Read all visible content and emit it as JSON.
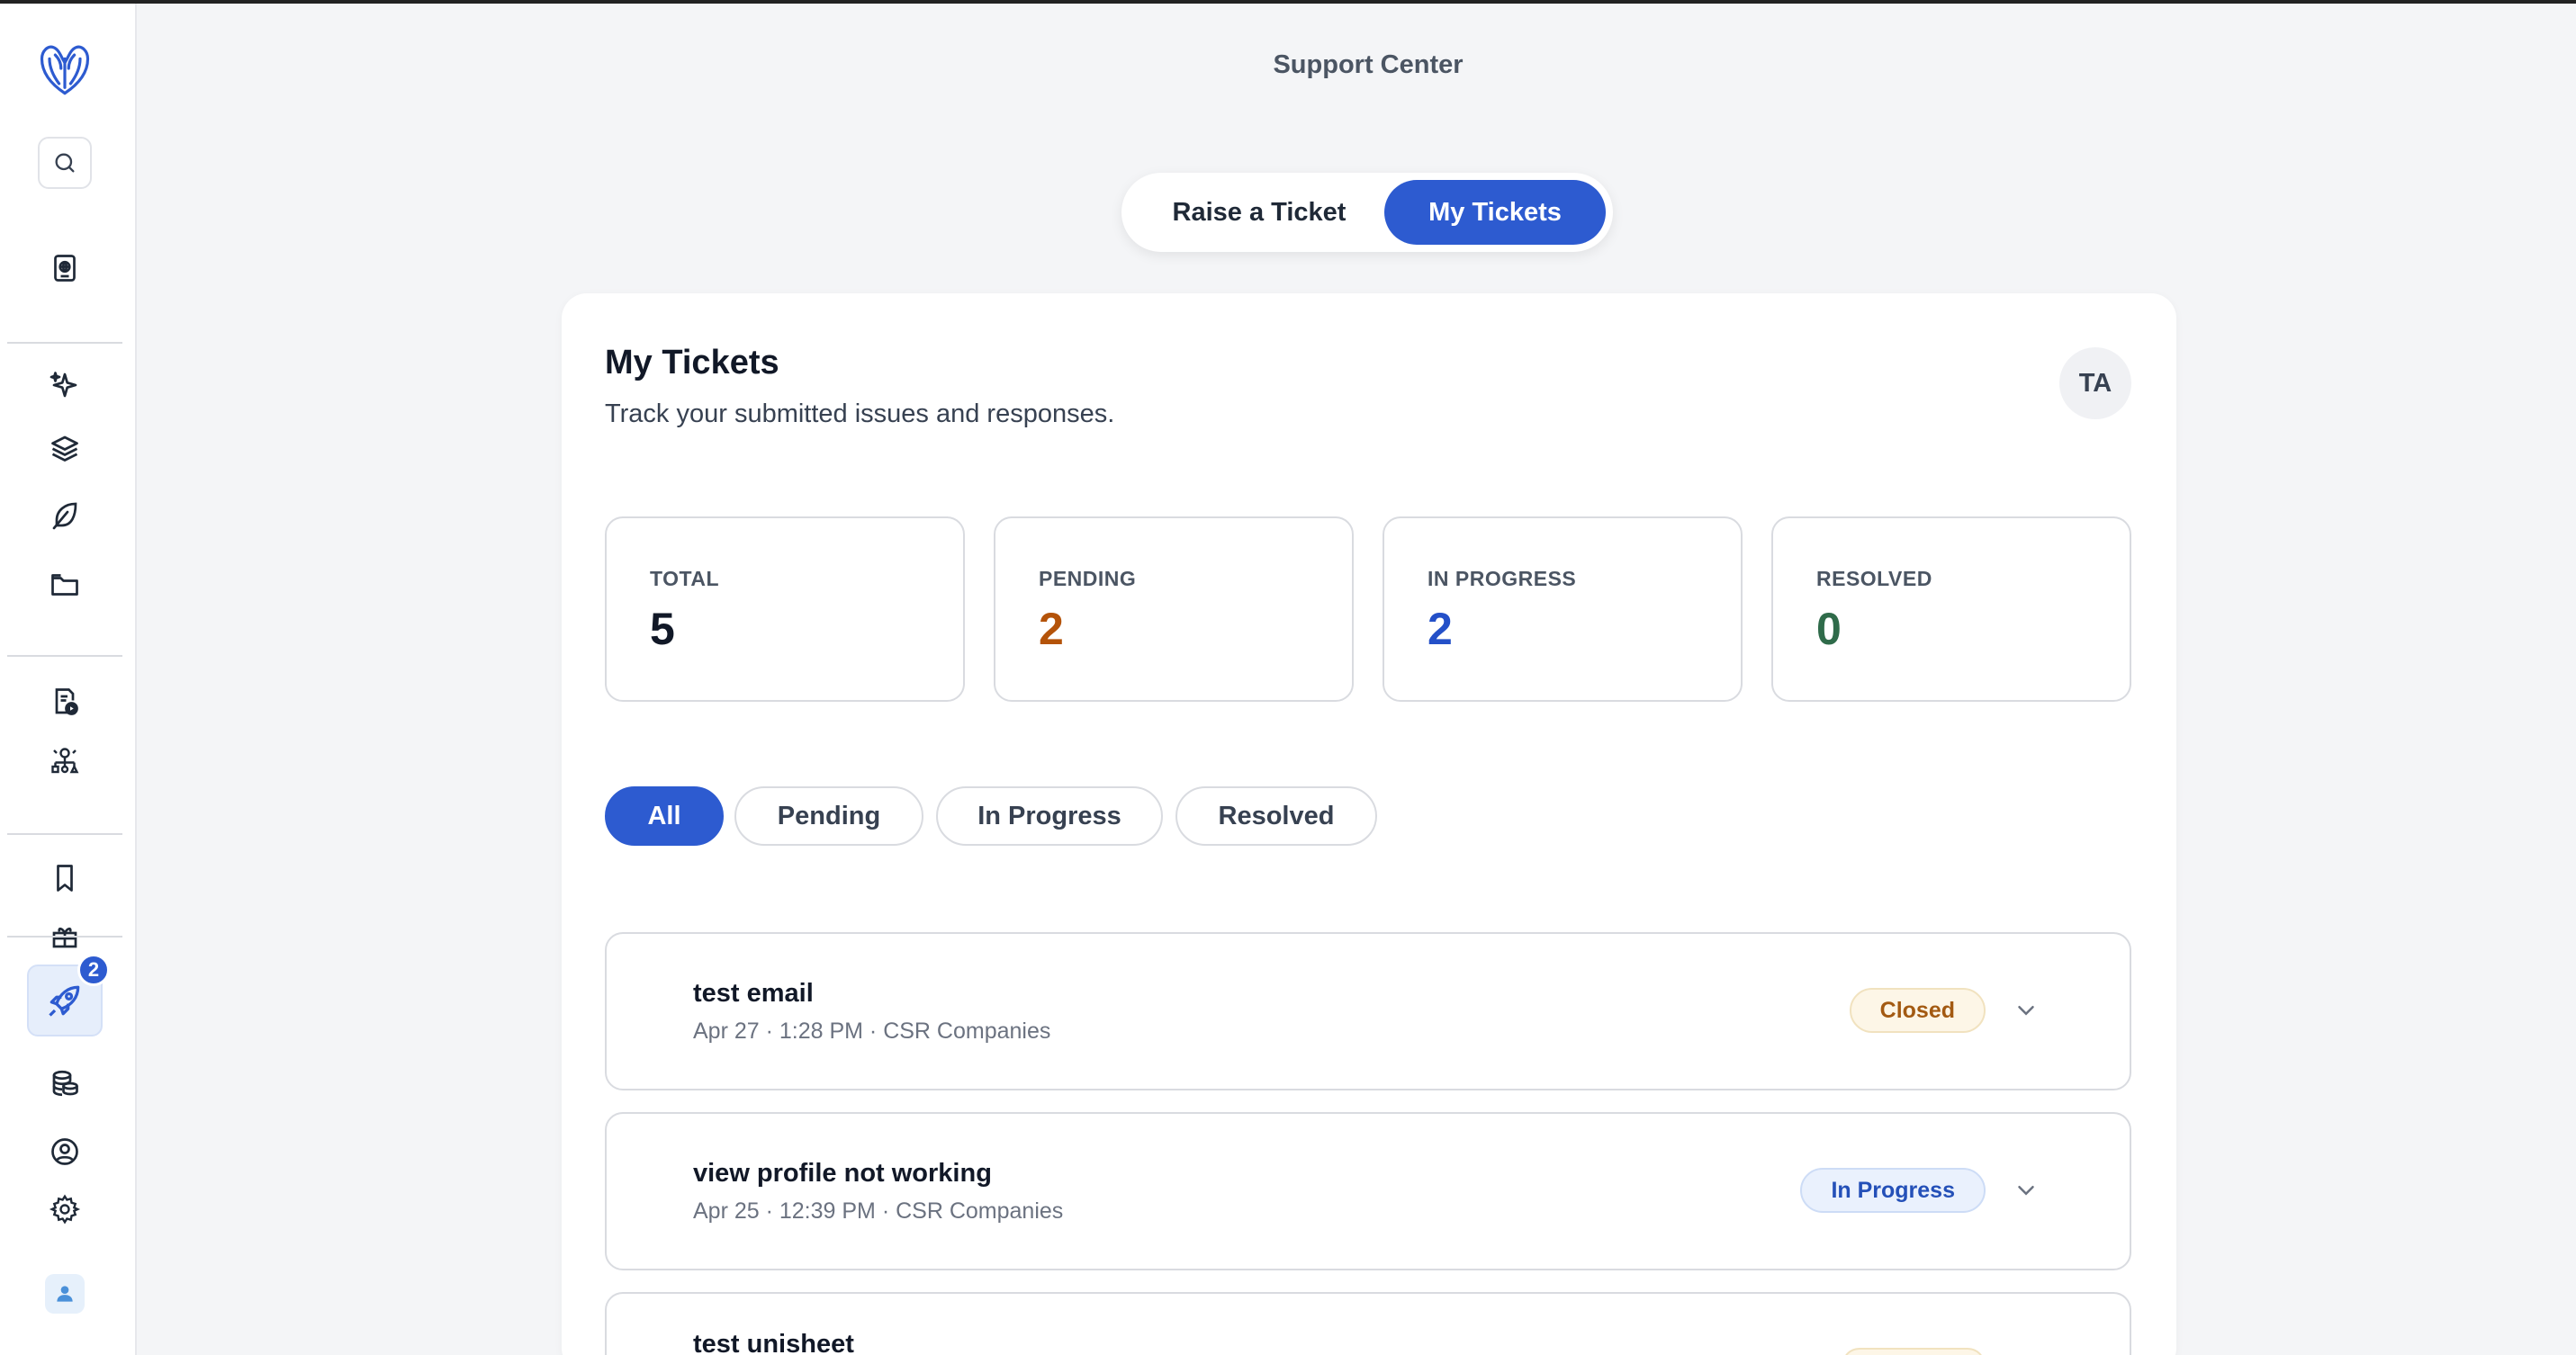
{
  "header": {
    "title": "Support Center"
  },
  "tabs": [
    {
      "label": "Raise a Ticket",
      "active": false
    },
    {
      "label": "My Tickets",
      "active": true
    }
  ],
  "card": {
    "title": "My Tickets",
    "subtitle": "Track your submitted issues and responses.",
    "avatar_initials": "TA"
  },
  "stats": [
    {
      "label": "TOTAL",
      "value": "5",
      "color": "#111827"
    },
    {
      "label": "PENDING",
      "value": "2",
      "color": "#b45309"
    },
    {
      "label": "IN PROGRESS",
      "value": "2",
      "color": "#2450c8"
    },
    {
      "label": "RESOLVED",
      "value": "0",
      "color": "#2f6b4a"
    }
  ],
  "filters": [
    {
      "label": "All",
      "selected": true
    },
    {
      "label": "Pending",
      "selected": false
    },
    {
      "label": "In Progress",
      "selected": false
    },
    {
      "label": "Resolved",
      "selected": false
    }
  ],
  "tickets": [
    {
      "title": "test email",
      "meta": "Apr 27 · 1:28 PM · CSR Companies",
      "status": "Closed"
    },
    {
      "title": "view profile not working",
      "meta": "Apr 25 · 12:39 PM · CSR Companies",
      "status": "In Progress"
    },
    {
      "title": "test unisheet",
      "meta": "",
      "status": ""
    }
  ],
  "sidebar": {
    "notification_count": "2",
    "icons": [
      "logo-icon",
      "search-icon",
      "passport-icon",
      "sparkles-icon",
      "layers-icon",
      "feather-icon",
      "folder-icon",
      "document-play-icon",
      "org-chart-icon",
      "bookmark-icon",
      "gift-icon",
      "rocket-icon",
      "coins-icon",
      "user-circle-icon",
      "gear-icon",
      "user-icon"
    ]
  },
  "colors": {
    "accent": "#2d5bd0",
    "background": "#f4f5f7"
  }
}
